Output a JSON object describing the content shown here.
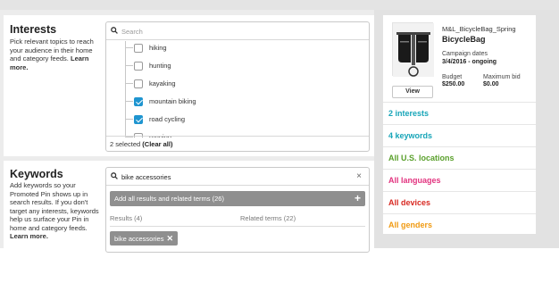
{
  "colors": {
    "teal": "#17a5b8",
    "green": "#5aa02c",
    "pink": "#e2337f",
    "red": "#d82a23",
    "orange": "#f09a12",
    "checkbox_blue": "#1f95d0"
  },
  "interests": {
    "title": "Interests",
    "description": "Pick relevant topics to reach your audience in their home and category feeds.",
    "learn_more": "Learn more.",
    "search_placeholder": "Search",
    "items": [
      {
        "label": "hiking",
        "checked": false
      },
      {
        "label": "hunting",
        "checked": false
      },
      {
        "label": "kayaking",
        "checked": false
      },
      {
        "label": "mountain biking",
        "checked": true
      },
      {
        "label": "road cycling",
        "checked": true
      },
      {
        "label": "running",
        "checked": false
      }
    ],
    "selected_text": "2 selected",
    "clear_all": "(Clear all)"
  },
  "keywords": {
    "title": "Keywords",
    "description": "Add keywords so your Promoted Pin shows up in search results. If you don't target any interests, keywords help us surface your Pin in home and category feeds.",
    "learn_more": "Learn more.",
    "search_value": "bike accessories",
    "clear_icon": "×",
    "add_all_label": "Add all results and related terms (26)",
    "add_icon": "+",
    "results_heading": "Results (4)",
    "related_heading": "Related terms (22)",
    "chip_label": "bike accessories",
    "chip_remove": "✕"
  },
  "preview": {
    "campaign_name": "M&L_BicycleBag_Spring",
    "pin_title": "BicycleBag",
    "campaign_dates_label": "Campaign dates",
    "campaign_dates_value": "3/4/2016 - ongoing",
    "budget_label": "Budget",
    "budget_value": "$250.00",
    "max_bid_label": "Maximum bid",
    "max_bid_value": "$0.00",
    "view_button": "View",
    "thumbnail_icon": "bicycle-bag-photo"
  },
  "summary": [
    {
      "label": "2 interests",
      "color": "#17a5b8"
    },
    {
      "label": "4 keywords",
      "color": "#17a5b8"
    },
    {
      "label": "All U.S. locations",
      "color": "#5aa02c"
    },
    {
      "label": "All languages",
      "color": "#e2337f"
    },
    {
      "label": "All devices",
      "color": "#d82a23"
    },
    {
      "label": "All genders",
      "color": "#f09a12"
    }
  ]
}
